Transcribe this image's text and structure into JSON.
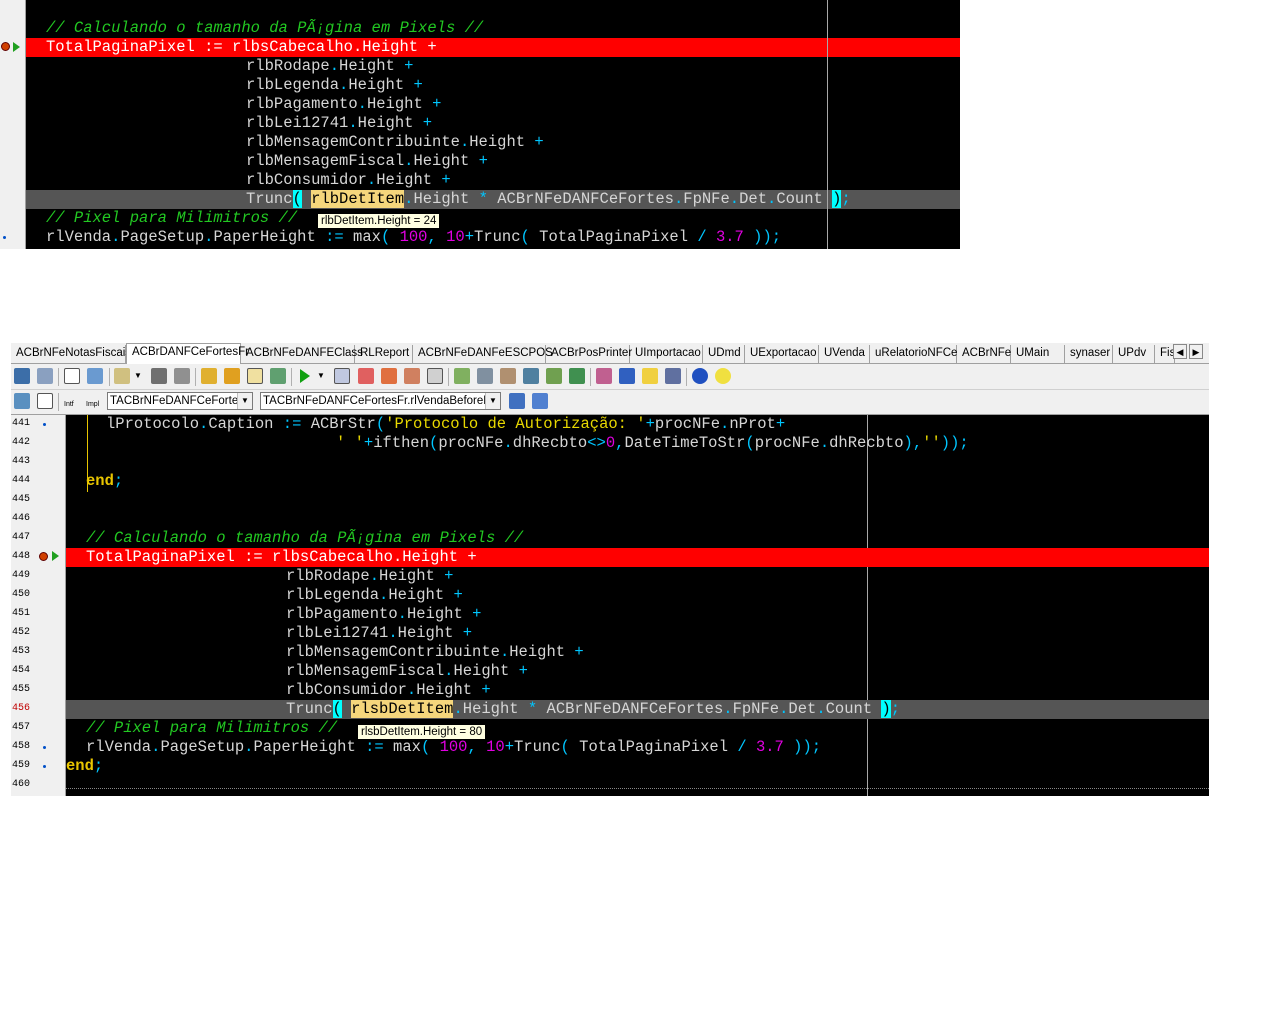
{
  "top_editor": {
    "lines": [
      {
        "text": "// Calculando o tamanho da PÃ¡gina em Pixels //",
        "kind": "comment",
        "indent": 2
      },
      {
        "text": "TotalPaginaPixel := rlbsCabecalho.Height +",
        "kind": "code",
        "indent": 2,
        "highlight": "breakpoint"
      },
      {
        "text": "rlbRodape.Height +",
        "kind": "code",
        "indent": 22
      },
      {
        "text": "rlbLegenda.Height +",
        "kind": "code",
        "indent": 22
      },
      {
        "text": "rlbPagamento.Height +",
        "kind": "code",
        "indent": 22
      },
      {
        "text": "rlbLei12741.Height +",
        "kind": "code",
        "indent": 22
      },
      {
        "text": "rlbMensagemContribuinte.Height +",
        "kind": "code",
        "indent": 22
      },
      {
        "text": "rlbMensagemFiscal.Height +",
        "kind": "code",
        "indent": 22
      },
      {
        "text": "rlbConsumidor.Height +",
        "kind": "code",
        "indent": 22
      },
      {
        "text": "Trunc( rlbDetItem.Height * ACBrNFeDANFCeFortes.FpNFe.Det.Count );",
        "kind": "code",
        "indent": 22,
        "highlight": "current"
      },
      {
        "text": "// Pixel para Milimitros //",
        "kind": "comment",
        "indent": 2
      },
      {
        "text": "rlVenda.PageSetup.PaperHeight := max( 100, 10+Trunc( TotalPaginaPixel / 3.7 ));",
        "kind": "code",
        "indent": 2
      }
    ],
    "tooltip": "rlbDetItem.Height = 24"
  },
  "tabs": [
    {
      "label": "ACBrNFeNotasFiscais",
      "active": false
    },
    {
      "label": "ACBrDANFCeFortesFr",
      "active": true
    },
    {
      "label": "ACBrNFeDANFEClass",
      "active": false
    },
    {
      "label": "RLReport",
      "active": false
    },
    {
      "label": "ACBrNFeDANFeESCPOS",
      "active": false
    },
    {
      "label": "ACBrPosPrinter",
      "active": false
    },
    {
      "label": "UImportacao",
      "active": false
    },
    {
      "label": "UDmd",
      "active": false
    },
    {
      "label": "UExportacao",
      "active": false
    },
    {
      "label": "UVenda",
      "active": false
    },
    {
      "label": "uRelatorioNFCe",
      "active": false
    },
    {
      "label": "ACBrNFe",
      "active": false
    },
    {
      "label": "UMain",
      "active": false
    },
    {
      "label": "synaser",
      "active": false
    },
    {
      "label": "UPdv",
      "active": false
    },
    {
      "label": "Fis",
      "active": false
    }
  ],
  "toolbar2": {
    "intf_label": "Intf",
    "impl_label": "Impl",
    "class_combo": "TACBrNFeDANFCeFortesF",
    "method_combo": "TACBrNFeDANFCeFortesFr.rlVendaBeforePrin"
  },
  "bottom_editor": {
    "lines": [
      {
        "num": "441",
        "text": "lProtocolo.Caption := ACBrStr('Protocolo de Autorização: '+procNFe.nProt+",
        "indent": 4,
        "dot": true
      },
      {
        "num": "442",
        "text": "' '+ifthen(procNFe.dhRecbto<>0,DateTimeToStr(procNFe.dhRecbto),''));",
        "indent": 27
      },
      {
        "num": "443",
        "text": "",
        "indent": 0
      },
      {
        "num": "444",
        "text": "end;",
        "indent": 2
      },
      {
        "num": "445",
        "text": "",
        "indent": 0
      },
      {
        "num": "446",
        "text": "",
        "indent": 0
      },
      {
        "num": "447",
        "text": "// Calculando o tamanho da PÃ¡gina em Pixels //",
        "indent": 2,
        "kind": "comment"
      },
      {
        "num": "448",
        "text": "TotalPaginaPixel := rlbsCabecalho.Height +",
        "indent": 2,
        "highlight": "breakpoint"
      },
      {
        "num": "449",
        "text": "rlbRodape.Height +",
        "indent": 22
      },
      {
        "num": "450",
        "text": "rlbLegenda.Height +",
        "indent": 22
      },
      {
        "num": "451",
        "text": "rlbPagamento.Height +",
        "indent": 22
      },
      {
        "num": "452",
        "text": "rlbLei12741.Height +",
        "indent": 22
      },
      {
        "num": "453",
        "text": "rlbMensagemContribuinte.Height +",
        "indent": 22
      },
      {
        "num": "454",
        "text": "rlbMensagemFiscal.Height +",
        "indent": 22
      },
      {
        "num": "455",
        "text": "rlbConsumidor.Height +",
        "indent": 22
      },
      {
        "num": "456",
        "text": "Trunc( rlsbDetItem.Height * ACBrNFeDANFCeFortes.FpNFe.Det.Count );",
        "indent": 22,
        "highlight": "current"
      },
      {
        "num": "457",
        "text": "// Pixel para Milimitros //",
        "indent": 2,
        "kind": "comment"
      },
      {
        "num": "458",
        "text": "rlVenda.PageSetup.PaperHeight := max( 100, 10+Trunc( TotalPaginaPixel / 3.7 ));",
        "indent": 2,
        "dot": true
      },
      {
        "num": "459",
        "text": "end;",
        "indent": 0,
        "dot": true
      },
      {
        "num": "460",
        "text": "",
        "indent": 0
      }
    ],
    "tooltip": "rlsbDetItem.Height = 80"
  },
  "colors": {
    "breakpoint_line": "#ff0000",
    "current_line": "#555555",
    "comment": "#22c822",
    "identifier": "#d6d6d6",
    "operator": "#00c6ff",
    "keyword": "#e8c500",
    "number": "#e000e0"
  }
}
